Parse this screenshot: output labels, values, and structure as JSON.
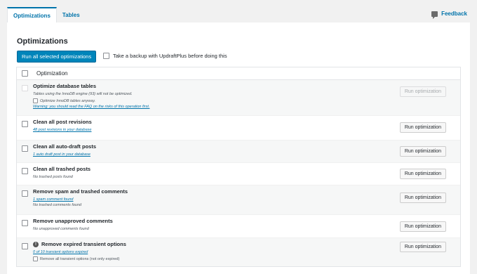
{
  "tabs": [
    {
      "label": "Optimizations"
    },
    {
      "label": "Tables"
    }
  ],
  "feedback_label": "Feedback",
  "heading": "Optimizations",
  "run_all_label": "Run all selected optimizations",
  "backup_label": "Take a backup with UpdraftPlus before doing this",
  "table_header": "Optimization",
  "button_label": "Run optimization",
  "rows": [
    {
      "title": "Optimize database tables",
      "lines": [
        "Tables using the InnoDB engine (93) will not be optimized."
      ],
      "inner_option": "Optimize InnoDB tables anyway.",
      "warning_link": "Warning: you should read the FAQ on the risks of this operation first."
    },
    {
      "title": "Clean all post revisions",
      "link": "48 post revisions in your database"
    },
    {
      "title": "Clean all auto-draft posts",
      "link": "1 auto draft post in your database"
    },
    {
      "title": "Clean all trashed posts",
      "line": "No trashed posts found"
    },
    {
      "title": "Remove spam and trashed comments",
      "link": "1 spam comment found",
      "line": "No trashed comments found"
    },
    {
      "title": "Remove unapproved comments",
      "line": "No unapproved comments found"
    },
    {
      "title": "Remove expired transient options",
      "link": "0 of 10 transient options expired",
      "inner_option": "Remove all transient options (not only expired)"
    }
  ]
}
